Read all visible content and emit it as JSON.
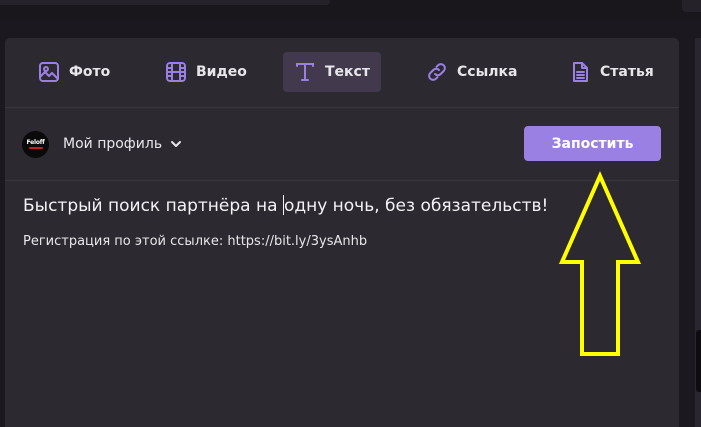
{
  "tabs": [
    {
      "label": "Фото",
      "icon": "image-icon",
      "active": false
    },
    {
      "label": "Видео",
      "icon": "film-icon",
      "active": false
    },
    {
      "label": "Текст",
      "icon": "text-t-icon",
      "active": true
    },
    {
      "label": "Ссылка",
      "icon": "link-icon",
      "active": false
    },
    {
      "label": "Статья",
      "icon": "document-icon",
      "active": false
    }
  ],
  "profile": {
    "name": "Мой профиль",
    "avatar_text": "Feloff",
    "dropdown_icon": "chevron-down-icon"
  },
  "post_button": {
    "label": "Запостить"
  },
  "editor": {
    "title_before_caret": "Быстрый поиск партнёра на ",
    "title_after_caret": "одну ночь, без обязательств!",
    "body": "Регистрация по этой ссылке: https://bit.ly/3ysAnhb"
  },
  "annotation": {
    "icon": "up-arrow-icon",
    "color": "#ffff00"
  },
  "colors": {
    "accent": "#9b80e3",
    "panel": "#2d2930",
    "background": "#1b181f",
    "active_tab": "#423a4c",
    "icon": "#9b80e3"
  }
}
